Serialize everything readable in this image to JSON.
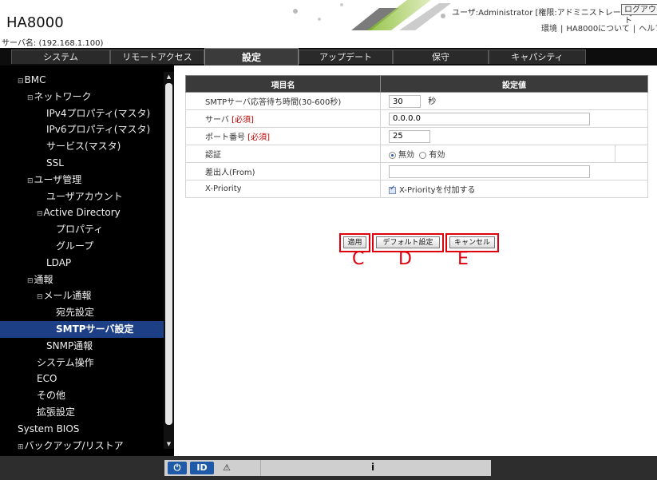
{
  "header": {
    "product": "HA8000",
    "server_name": "サーバ名: (192.168.1.100)",
    "user_line": "ユーザ:Administrator [権限:アドミニストレータ]",
    "logout": "ログアウト",
    "links": [
      "環境",
      "HA8000について",
      "ヘルプ"
    ]
  },
  "tabs": [
    "システム",
    "リモートアクセス",
    "設定",
    "アップデート",
    "保守",
    "キャパシティ"
  ],
  "active_tab": "設定",
  "sidebar": {
    "items": [
      {
        "label": "BMC",
        "expander": "⊟"
      },
      {
        "label": "ネットワーク",
        "expander": "⊟"
      },
      {
        "label": "IPv4プロパティ(マスタ)"
      },
      {
        "label": "IPv6プロパティ(マスタ)"
      },
      {
        "label": "サービス(マスタ)"
      },
      {
        "label": "SSL"
      },
      {
        "label": "ユーザ管理",
        "expander": "⊟"
      },
      {
        "label": "ユーザアカウント"
      },
      {
        "label": "Active Directory",
        "expander": "⊟"
      },
      {
        "label": "プロパティ"
      },
      {
        "label": "グループ"
      },
      {
        "label": "LDAP"
      },
      {
        "label": "通報",
        "expander": "⊟"
      },
      {
        "label": "メール通報",
        "expander": "⊟"
      },
      {
        "label": "宛先設定"
      },
      {
        "label": "SMTPサーバ設定"
      },
      {
        "label": "SNMP通報"
      },
      {
        "label": "システム操作"
      },
      {
        "label": "ECO"
      },
      {
        "label": "その他"
      },
      {
        "label": "拡張設定"
      },
      {
        "label": "System BIOS"
      },
      {
        "label": "バックアップ/リストア",
        "expander": "⊞"
      }
    ]
  },
  "table": {
    "header_name": "項目名",
    "header_value": "設定値",
    "rows": {
      "smtp_timeout": {
        "label": "SMTPサーバ応答待ち時間(30-600秒)",
        "value": "30",
        "unit": "秒"
      },
      "server": {
        "label": "サーバ",
        "required": "[必須]",
        "value": "0.0.0.0"
      },
      "port": {
        "label": "ポート番号",
        "required": "[必須]",
        "value": "25"
      },
      "auth": {
        "label": "認証",
        "option_off": "無効",
        "option_on": "有効",
        "selected": "無効"
      },
      "from": {
        "label": "差出人(From)",
        "value": ""
      },
      "priority": {
        "label": "X-Priority",
        "checkbox_label": "X-Priorityを付加する",
        "checked": true
      }
    }
  },
  "buttons": {
    "apply": "適用",
    "default": "デフォルト設定",
    "cancel": "キャンセル"
  },
  "annotations": [
    "C",
    "D",
    "E"
  ],
  "statusbar": {
    "info_icon": "i"
  },
  "colors": {
    "annotation": "#e0000c",
    "selected": "#1c3f86",
    "required": "#c00000"
  }
}
